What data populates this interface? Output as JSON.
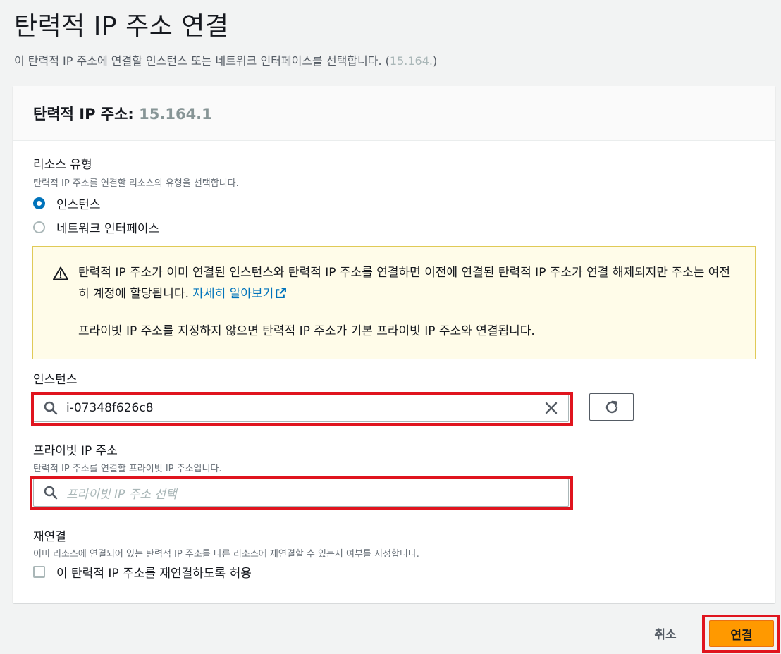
{
  "page": {
    "title": "탄력적 IP 주소 연결",
    "description": "이 탄력적 IP 주소에 연결할 인스턴스 또는 네트워크 인터페이스를 선택합니다. (",
    "description_masked": "15.164.",
    "description_end": ")"
  },
  "panel": {
    "title_prefix": "탄력적 IP 주소: ",
    "title_masked": "15.164.1"
  },
  "resource_type": {
    "label": "리소스 유형",
    "hint": "탄력적 IP 주소를 연결할 리소스의 유형을 선택합니다.",
    "options": [
      {
        "label": "인스턴스",
        "selected": true
      },
      {
        "label": "네트워크 인터페이스",
        "selected": false
      }
    ]
  },
  "alert": {
    "text": "탄력적 IP 주소가 이미 연결된 인스턴스와 탄력적 IP 주소를 연결하면 이전에 연결된 탄력적 IP 주소가 연결 해제되지만 주소는 여전히 계정에 할당됩니다. ",
    "link": "자세히 알아보기",
    "text2": "프라이빗 IP 주소를 지정하지 않으면 탄력적 IP 주소가 기본 프라이빗 IP 주소와 연결됩니다."
  },
  "instance": {
    "label": "인스턴스",
    "value": "i-07348f626c8"
  },
  "private_ip": {
    "label": "프라이빗 IP 주소",
    "hint": "탄력적 IP 주소를 연결할 프라이빗 IP 주소입니다.",
    "placeholder": "프라이빗 IP 주소 선택"
  },
  "reassociation": {
    "label": "재연결",
    "hint": "이미 리소스에 연결되어 있는 탄력적 IP 주소를 다른 리소스에 재연결할 수 있는지 여부를 지정합니다.",
    "checkbox_label": "이 탄력적 IP 주소를 재연결하도록 허용",
    "checked": false
  },
  "footer": {
    "cancel_label": "취소",
    "submit_label": "연결"
  },
  "colors": {
    "primary": "#ff9900",
    "link": "#0073bb",
    "highlight": "#e0141e",
    "warning_bg": "#fffce9"
  }
}
